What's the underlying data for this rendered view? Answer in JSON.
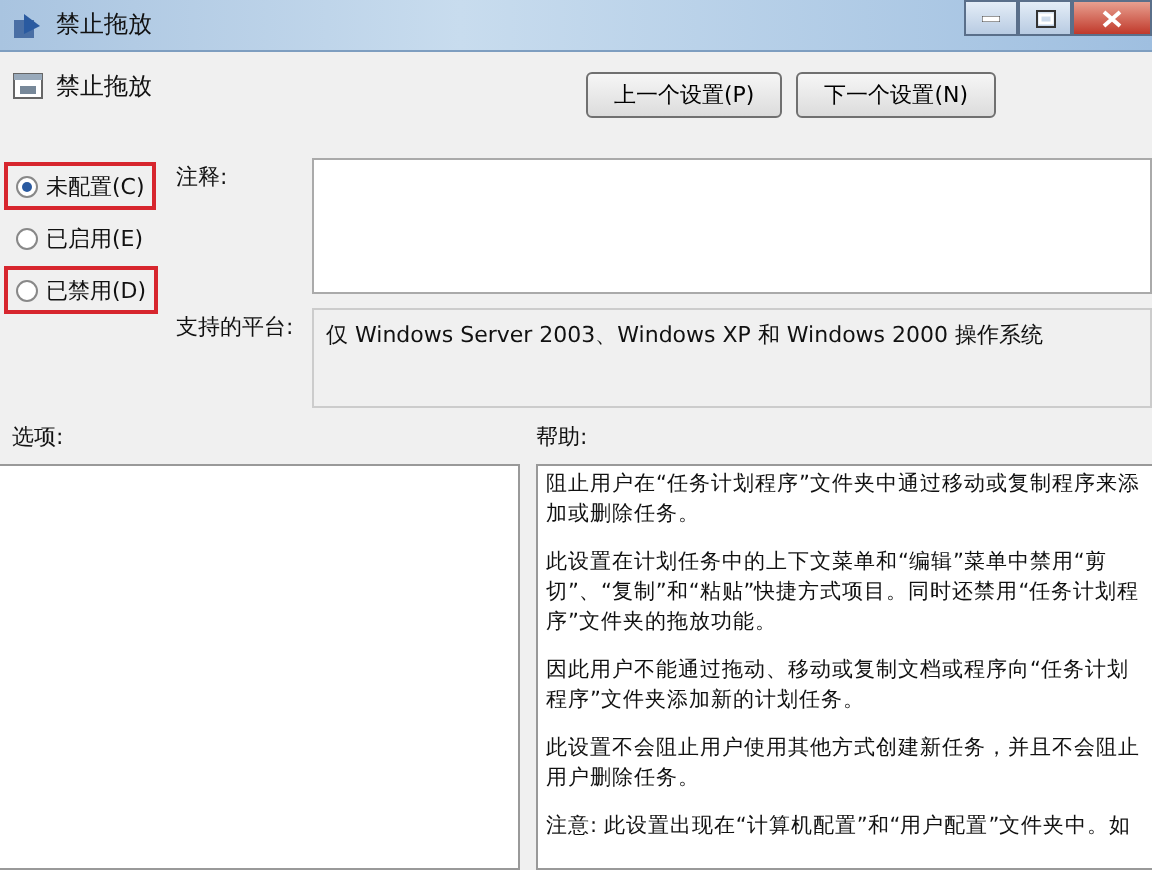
{
  "window": {
    "title": "禁止拖放"
  },
  "header": {
    "title": "禁止拖放",
    "buttons": [
      "上一个设置(P)",
      "下一个设置(N)"
    ]
  },
  "states": [
    {
      "label": "未配置(C)",
      "selected": true,
      "highlighted": true
    },
    {
      "label": "已启用(E)",
      "selected": false,
      "highlighted": false
    },
    {
      "label": "已禁用(D)",
      "selected": false,
      "highlighted": true
    }
  ],
  "comment": {
    "label": "注释:"
  },
  "platform": {
    "label": "支持的平台:",
    "value": "仅 Windows Server 2003、Windows XP 和 Windows 2000 操作系统"
  },
  "options": {
    "label": "选项:"
  },
  "help": {
    "label": "帮助:",
    "paragraphs": [
      "阻止用户在“任务计划程序”文件夹中通过移动或复制程序来添加或删除任务。",
      "此设置在计划任务中的上下文菜单和“编辑”菜单中禁用“剪切”、“复制”和“粘贴”快捷方式项目。同时还禁用“任务计划程序”文件夹的拖放功能。",
      "因此用户不能通过拖动、移动或复制文档或程序向“任务计划程序”文件夹添加新的计划任务。",
      "此设置不会阻止用户使用其他方式创建新任务，并且不会阻止用户删除任务。",
      "注意: 此设置出现在“计算机配置”和“用户配置”文件夹中。如"
    ]
  }
}
